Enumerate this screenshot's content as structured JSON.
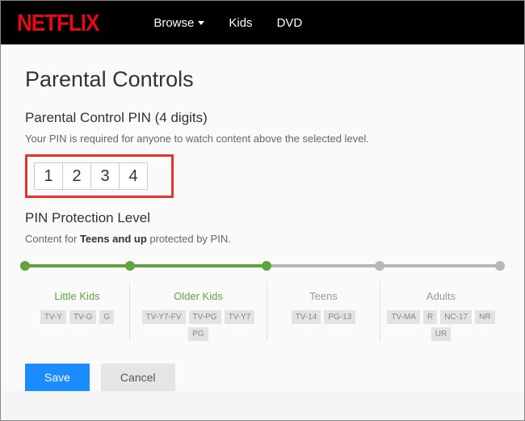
{
  "header": {
    "logo_text": "NETFLIX",
    "nav": [
      {
        "label": "Browse",
        "has_dropdown": true
      },
      {
        "label": "Kids",
        "has_dropdown": false
      },
      {
        "label": "DVD",
        "has_dropdown": false
      }
    ]
  },
  "page_title": "Parental Controls",
  "pin_section": {
    "heading": "Parental Control PIN (4 digits)",
    "description": "Your PIN is required for anyone to watch content above the selected level.",
    "digits": [
      "1",
      "2",
      "3",
      "4"
    ]
  },
  "level_section": {
    "heading": "PIN Protection Level",
    "prefix": "Content for ",
    "bold": "Teens and up",
    "suffix": " protected by PIN.",
    "selected_index": 2,
    "levels": [
      {
        "name": "Little Kids",
        "ratings": [
          "TV-Y",
          "TV-G",
          "G"
        ]
      },
      {
        "name": "Older Kids",
        "ratings": [
          "TV-Y7-FV",
          "TV-PG",
          "TV-Y7",
          "PG"
        ]
      },
      {
        "name": "Teens",
        "ratings": [
          "TV-14",
          "PG-13"
        ]
      },
      {
        "name": "Adults",
        "ratings": [
          "TV-MA",
          "R",
          "NC-17",
          "NR",
          "UR"
        ]
      }
    ]
  },
  "actions": {
    "save_label": "Save",
    "cancel_label": "Cancel"
  },
  "colors": {
    "brand": "#E50914",
    "accent": "#5fa53f",
    "primary_btn": "#1a8cff",
    "highlight_border": "#e7322d"
  }
}
